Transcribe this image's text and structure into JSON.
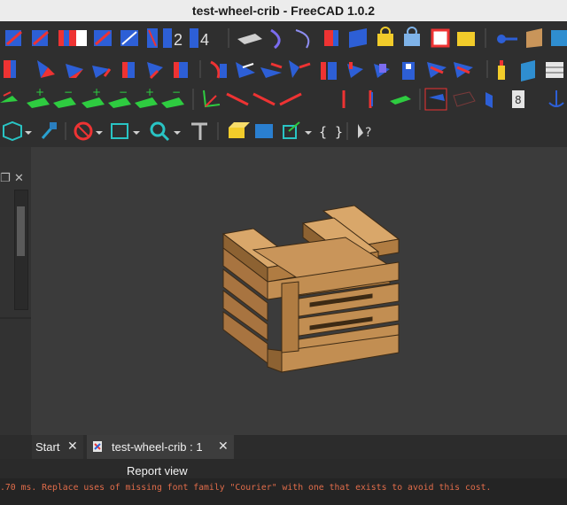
{
  "window": {
    "title": "test-wheel-crib - FreeCAD 1.0.2"
  },
  "toolbar_row1": [
    "sketch-constraint-icons",
    "number-2-icon",
    "number-4-icon",
    "sketch-tools-icons"
  ],
  "toolbar_row1_text": {
    "two": "2",
    "four": "4"
  },
  "toolbar_row4": {
    "braces_label": "{ }",
    "whats_this": "?"
  },
  "tabs": [
    {
      "label": "Start"
    },
    {
      "label": "test-wheel-crib : 1"
    }
  ],
  "report": {
    "title": "Report view",
    "message": ".70 ms. Replace uses of missing font family \"Courier\" with one that exists to avoid this cost."
  },
  "colors": {
    "accent_red": "#e04030",
    "accent_blue": "#2f5fe0",
    "wood": "#c9955a",
    "report_text": "#e06c4a"
  }
}
